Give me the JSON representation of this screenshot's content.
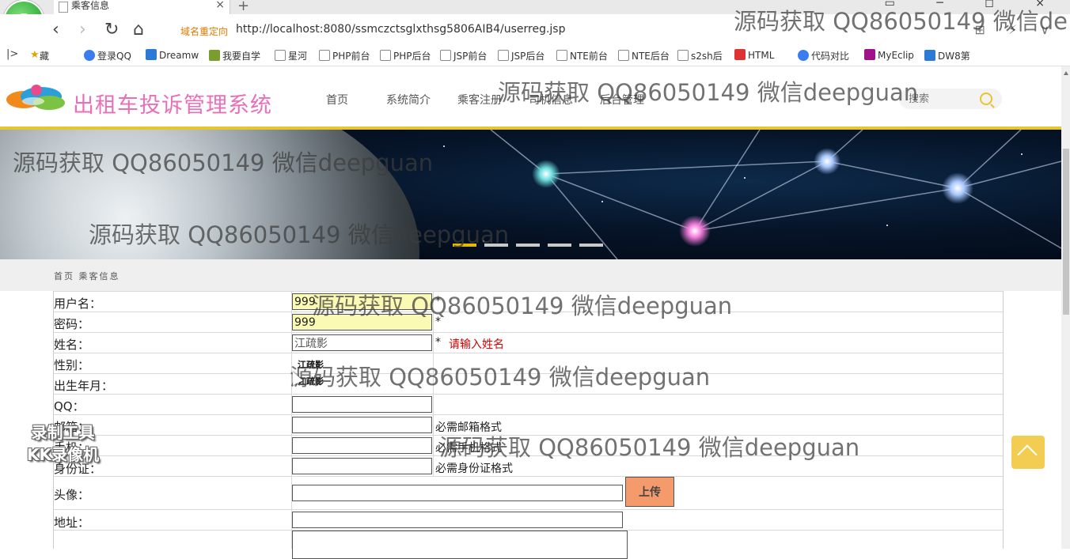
{
  "browser": {
    "tab_title": "乘客信息",
    "new_tab_symbol": "+",
    "tab_close_symbol": "×",
    "redirect_label": "域名重定向",
    "url": "http://localhost:8080/ssmczctsglxthsg5806AIB4/userreg.jsp",
    "logo_letter": "e",
    "nav_back_symbol": "‹",
    "nav_forward_symbol": "›",
    "nav_refresh_symbol": "↻",
    "nav_home_symbol": "⌂",
    "addr_icons": "⊞ ⚡ ∨",
    "window_controls": "▭ ─ ◻ ×",
    "bookmark_sidebar_symbol": "|>",
    "bookmarks": [
      {
        "label": "收藏",
        "icon": "star-icon"
      },
      {
        "label": "登录QQ",
        "icon": "qq-icon"
      },
      {
        "label": "Dreamw",
        "icon": "dreamweaver-icon"
      },
      {
        "label": "我要自学",
        "icon": "page-icon"
      },
      {
        "label": "星河",
        "icon": "page-icon"
      },
      {
        "label": "PHP前台",
        "icon": "page-icon"
      },
      {
        "label": "PHP后台",
        "icon": "page-icon"
      },
      {
        "label": "JSP前台",
        "icon": "page-icon"
      },
      {
        "label": "JSP后台",
        "icon": "page-icon"
      },
      {
        "label": "NTE前台",
        "icon": "page-icon"
      },
      {
        "label": "NTE后台",
        "icon": "page-icon"
      },
      {
        "label": "s2sh后",
        "icon": "image-icon"
      },
      {
        "label": "HTML",
        "icon": "html-icon"
      },
      {
        "label": "代码对比",
        "icon": "compare-icon"
      },
      {
        "label": "MyEclip",
        "icon": "myeclipse-icon"
      },
      {
        "label": "DW8第",
        "icon": "paw-icon"
      }
    ]
  },
  "site": {
    "name": "出租车投诉管理系统",
    "nav": [
      "首页",
      "系统简介",
      "乘客注册",
      "司机信息",
      "后台管理"
    ],
    "search_placeholder": "搜索",
    "breadcrumb": "首页 乘客信息",
    "slider_dots": 5,
    "slider_active": 0
  },
  "form": {
    "fields": [
      {
        "label": "用户名：",
        "value": "999",
        "required": "*",
        "state": "filled"
      },
      {
        "label": "密码：",
        "value": "999",
        "required": "*",
        "state": "filled"
      },
      {
        "label": "姓名：",
        "value": "江疏影",
        "required": "*",
        "error": "请输入姓名"
      },
      {
        "label": "性别："
      },
      {
        "label": "出生年月："
      },
      {
        "label": "QQ：",
        "value": ""
      },
      {
        "label": "邮箱：",
        "value": "",
        "hint": "必需邮箱格式"
      },
      {
        "label": "手机：",
        "value": "",
        "hint": "必需手机格式"
      },
      {
        "label": "身份证：",
        "value": "",
        "hint": "必需身份证格式"
      },
      {
        "label": "头像：",
        "value": ""
      },
      {
        "label": "地址：",
        "value": ""
      }
    ],
    "autocomplete": [
      "江疏影",
      "江疏影"
    ],
    "upload_label": "上传"
  },
  "watermarks": {
    "text_full": "源码获取 QQ86050149 微信deepguan",
    "text_cut": "源码获取 QQ86050149 微信de",
    "recorder_line1": "录制工具",
    "recorder_line2": "KK录像机"
  },
  "colors": {
    "brand": "#e86fb8",
    "accent": "#e3c630",
    "error": "#d80000",
    "upload_button": "#f59a6b",
    "filled_input": "#fafab4"
  }
}
